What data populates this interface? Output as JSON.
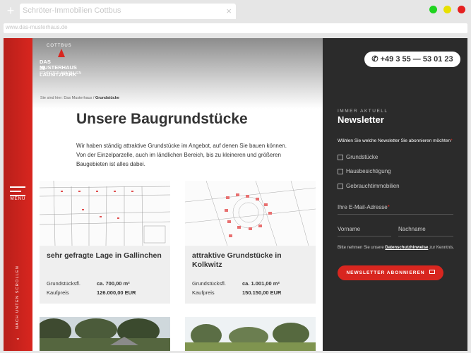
{
  "browser": {
    "tab_title": "Schröter-Immobilien Cottbus",
    "tab_close": "×",
    "new_tab": "+",
    "url": "www.das-musterhaus.de",
    "dots": [
      "#1fd41f",
      "#e8e000",
      "#e52020"
    ]
  },
  "logo": {
    "arc": "COTTBUS",
    "line1": "DAS MUSTERHAUS",
    "line2": "IM LAUSITZPARK",
    "line3": "SCHRÖTER-IMMOBILIEN"
  },
  "sidebar_left": {
    "menu_label": "MENÜ",
    "scroll_label": "NACH UNTEN SCROLLEN",
    "scroll_arrow": "⌄"
  },
  "breadcrumb": {
    "prefix": "Sie sind hier: Das Musterhaus  /  ",
    "current": "Grundstücke"
  },
  "main": {
    "title": "Unsere Baugrundstücke",
    "intro": "Wir haben ständig attraktive Grundstücke im Angebot, auf denen Sie bauen können. Von der Einzelparzelle, auch im ländlichen Bereich, bis zu kleineren und größeren Baugebieten ist alles dabei."
  },
  "cards": [
    {
      "title": "sehr gefragte Lage in Gallinchen",
      "size_label": "Grundstücksfl.",
      "size_value": "ca. 700,00 m²",
      "price_label": "Kaufpreis",
      "price_value": "126.000,00 EUR"
    },
    {
      "title": "attraktive Grundstücke in Kolkwitz",
      "size_label": "Grundstücksfl.",
      "size_value": "ca. 1.001,00 m²",
      "price_label": "Kaufpreis",
      "price_value": "150.150,00 EUR"
    }
  ],
  "side": {
    "phone": "+49 3 55 — 53 01 23",
    "kicker": "IMMER AKTUELL",
    "title": "Newsletter",
    "choose": "Wählen Sie welche Newsletter Sie abonnieren möchten",
    "req": "*",
    "options": [
      "Grundstücke",
      "Hausbesichtigung",
      "Gebrauchtimmobilien"
    ],
    "email_label": "Ihre E-Mail-Adresse",
    "first_name": "Vorname",
    "last_name": "Nachname",
    "privacy_pre": "Bitte nehmen Sie unsere ",
    "privacy_link": "Datenschutzhinweise",
    "privacy_post": " zur Kenntnis.",
    "subscribe": "NEWSLETTER ABONNIEREN"
  }
}
